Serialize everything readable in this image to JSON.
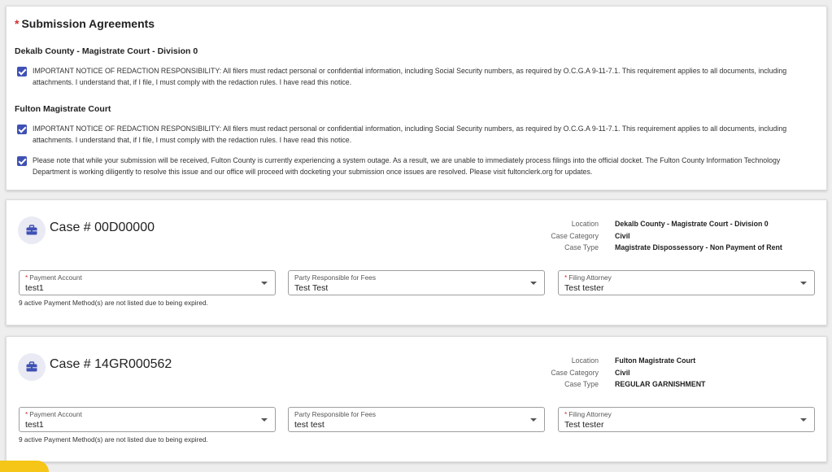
{
  "agreements": {
    "required_mark": "*",
    "title": "Submission Agreements",
    "courts": [
      {
        "name": "Dekalb County - Magistrate Court - Division 0",
        "notices": [
          {
            "checked": true,
            "text": "IMPORTANT NOTICE OF REDACTION RESPONSIBILITY: All filers must redact personal or confidential information, including Social Security numbers, as required by O.C.G.A 9-11-7.1. This requirement applies to all documents, including attachments. I understand that, if I file, I must comply with the redaction rules. I have read this notice."
          }
        ]
      },
      {
        "name": "Fulton Magistrate Court",
        "notices": [
          {
            "checked": true,
            "text": "IMPORTANT NOTICE OF REDACTION RESPONSIBILITY: All filers must redact personal or confidential information, including Social Security numbers, as required by O.C.G.A 9-11-7.1. This requirement applies to all documents, including attachments. I understand that, if I file, I must comply with the redaction rules. I have read this notice."
          },
          {
            "checked": true,
            "text": "Please note that while your submission will be received, Fulton County is currently experiencing a system outage. As a result, we are unable to immediately process filings into the official docket. The Fulton County Information Technology Department is working diligently to resolve this issue and our office will proceed with docketing your submission once issues are resolved. Please visit fultonclerk.org for updates."
          }
        ]
      }
    ]
  },
  "cases": [
    {
      "icon": "briefcase-icon",
      "title": "Case # 00D00000",
      "location_label": "Location",
      "location": "Dekalb County - Magistrate Court - Division 0",
      "category_label": "Case Category",
      "category": "Civil",
      "type_label": "Case Type",
      "type": "Magistrate Dispossessory - Non Payment of Rent",
      "payment_account": {
        "required_mark": "*",
        "label": "Payment Account",
        "value": "test1"
      },
      "party_responsible": {
        "label": "Party Responsible for Fees",
        "value": "Test Test"
      },
      "filing_attorney": {
        "required_mark": "*",
        "label": "Filing Attorney",
        "value": "Test tester"
      },
      "expired_note": "9 active Payment Method(s) are not listed due to being expired."
    },
    {
      "icon": "briefcase-icon",
      "title": "Case # 14GR000562",
      "location_label": "Location",
      "location": "Fulton Magistrate Court",
      "category_label": "Case Category",
      "category": "Civil",
      "type_label": "Case Type",
      "type": "REGULAR GARNISHMENT",
      "payment_account": {
        "required_mark": "*",
        "label": "Payment Account",
        "value": "test1"
      },
      "party_responsible": {
        "label": "Party Responsible for Fees",
        "value": "test test"
      },
      "filing_attorney": {
        "required_mark": "*",
        "label": "Filing Attorney",
        "value": "Test tester"
      },
      "expired_note": "9 active Payment Method(s) are not listed due to being expired."
    }
  ],
  "colors": {
    "accent": "#3f51b5",
    "required": "#d32f2f",
    "icon_bg": "#e9eaf4",
    "fab": "#f5c518"
  }
}
